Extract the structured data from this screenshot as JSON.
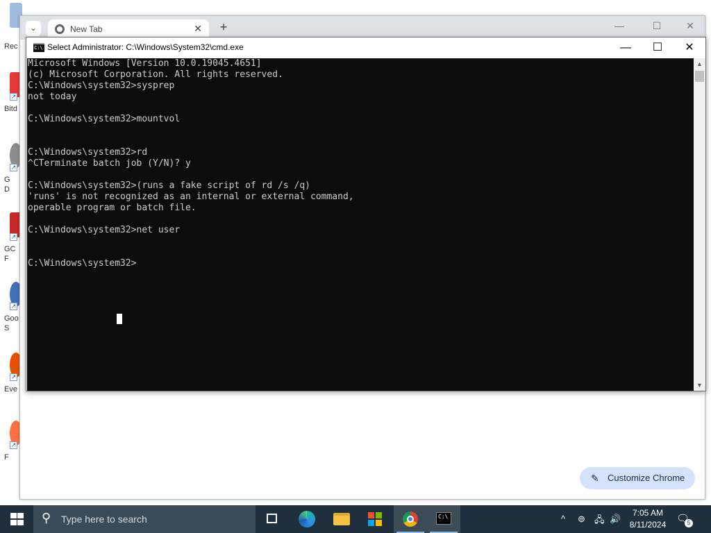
{
  "desktop": {
    "icons": [
      {
        "label": "Rec",
        "icon": "recycle-bin-icon",
        "color": "#7fa7d6"
      },
      {
        "label": "Bitd",
        "icon": "app-shortcut-icon",
        "color": "#e53935"
      },
      {
        "label": "G\nD",
        "icon": "app-shortcut-icon",
        "color": "#8c8c8c"
      },
      {
        "label": "GC\nF",
        "icon": "app-shortcut-icon",
        "color": "#c62828"
      },
      {
        "label": "Goo\nS",
        "icon": "app-shortcut-icon",
        "color": "#3f6fb5"
      },
      {
        "label": "Eve",
        "icon": "app-shortcut-icon",
        "color": "#e65100"
      },
      {
        "label": "F",
        "icon": "firefox-icon",
        "color": "#ff7043"
      }
    ]
  },
  "chrome": {
    "tab_title": "New Tab",
    "new_tab_symbol": "+",
    "close_tab_symbol": "✕",
    "tab_search_symbol": "⌄",
    "controls": {
      "minimize": "—",
      "maximize": "☐",
      "close": "✕"
    },
    "customize_label": "Customize Chrome",
    "customize_icon": "pencil-icon",
    "accent_color": "#d3e3fd"
  },
  "cmd": {
    "title": "Select Administrator:  C:\\Windows\\System32\\cmd.exe",
    "icon_text": "C:\\",
    "controls": {
      "minimize": "—",
      "maximize": "☐",
      "close": "✕"
    },
    "background_color": "#0c0c0c",
    "text_color": "#cccccc",
    "lines": [
      "Microsoft Windows [Version 10.0.19045.4651]",
      "(c) Microsoft Corporation. All rights reserved.",
      "C:\\Windows\\system32>sysprep",
      "not today",
      "",
      "C:\\Windows\\system32>mountvol",
      "",
      "",
      "C:\\Windows\\system32>rd",
      "^CTerminate batch job (Y/N)? y",
      "",
      "C:\\Windows\\system32>(runs a fake script of rd /s /q)",
      "'runs' is not recognized as an internal or external command,",
      "operable program or batch file.",
      "",
      "C:\\Windows\\system32>net user",
      "",
      "",
      "C:\\Windows\\system32>"
    ]
  },
  "taskbar": {
    "search_placeholder": "Type here to search",
    "search_icon": "magnifier-icon",
    "apps": [
      {
        "name": "task-view",
        "icon": "task-view-icon"
      },
      {
        "name": "edge",
        "icon": "edge-icon"
      },
      {
        "name": "file-explorer",
        "icon": "folder-icon"
      },
      {
        "name": "store",
        "icon": "store-icon"
      },
      {
        "name": "chrome",
        "icon": "chrome-icon"
      },
      {
        "name": "cmd",
        "icon": "cmd-icon"
      }
    ],
    "tray": {
      "chevron": "^",
      "meet_now": "⊚",
      "network": "🖧",
      "volume": "🔊"
    },
    "time": "7:05 AM",
    "date": "8/11/2024",
    "notification_count": "5",
    "bar_color": "#1f2f3d"
  }
}
